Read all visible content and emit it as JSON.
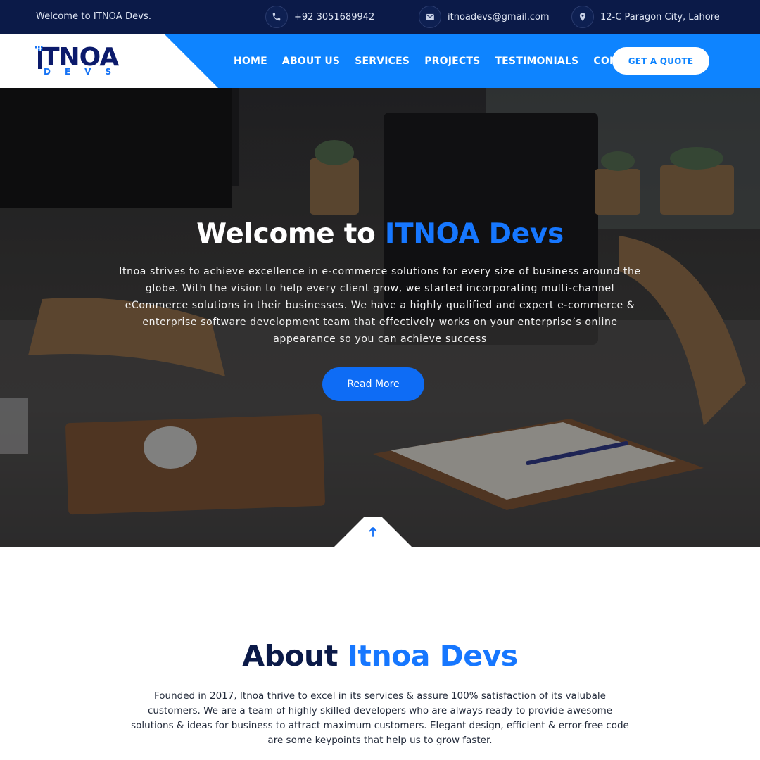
{
  "topbar": {
    "welcome": "Welcome to ITNOA Devs.",
    "phone": "+92 3051689942",
    "email": "itnoadevs@gmail.com",
    "address": "12-C Paragon City, Lahore",
    "icons": [
      "phone-icon",
      "envelope-icon",
      "map-pin-icon"
    ]
  },
  "logo": {
    "brand": "TNOA",
    "sub": "DEVS"
  },
  "nav": {
    "items": [
      "HOME",
      "ABOUT US",
      "SERVICES",
      "PROJECTS",
      "TESTIMONIALS",
      "CONTACT US"
    ],
    "cta": "GET A QUOTE"
  },
  "hero": {
    "title_prefix": "Welcome to ",
    "title_accent": "ITNOA Devs",
    "text": "Itnoa strives to achieve excellence in e-commerce solutions for every size of business around the globe. With the vision to help every client grow, we started incorporating multi-channel eCommerce solutions in their businesses. We have a highly qualified and expert e-commerce & enterprise software development team that effectively works on your enterprise’s online appearance so you can achieve success",
    "button": "Read More"
  },
  "about": {
    "title_prefix": "About ",
    "title_accent": "Itnoa Devs",
    "text": "Founded in 2017, Itnoa thrive to excel in its services & assure 100% satisfaction of its valubale customers. We are a team of highly skilled developers who are always ready to provide awesome solutions & ideas for business to attract maximum customers. Elegant design, efficient & error-free code are some keypoints that help us to grow faster."
  },
  "colors": {
    "navy": "#0b1a48",
    "primary": "#0e84ff",
    "accent": "#1677ff",
    "button": "#0e6cf5"
  }
}
